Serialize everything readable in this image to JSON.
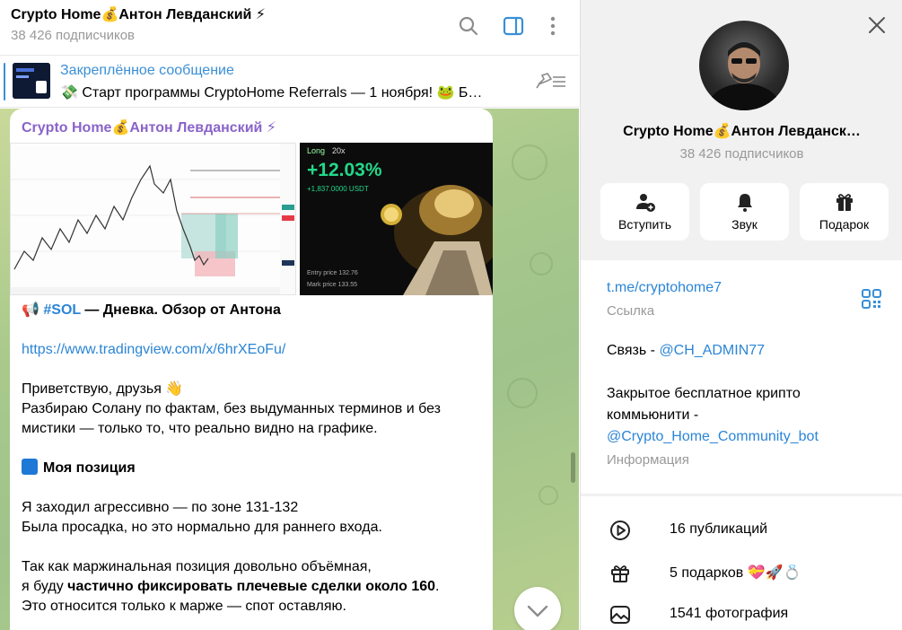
{
  "header": {
    "title": "Crypto Home💰Антон Левданский ⚡",
    "subscribers": "38 426 подписчиков"
  },
  "pinned": {
    "label": "Закреплённое сообщение",
    "text": "💸 Старт программы CryptoHome Referrals — 1 ноября! 🐸 Б…"
  },
  "message": {
    "author": "Crypto Home💰Антон Левданский ⚡",
    "media_right": {
      "mode": "Long",
      "leverage": "20x",
      "pnl_percent": "+12.03%",
      "pnl_usdt": "+1,837.0000 USDT",
      "entry_price": "Entry price  132.76",
      "mark_price": "Mark price  133.55"
    },
    "hashtag": "#SOL",
    "title_rest": " — Дневка. Обзор от Антона",
    "link": "https://www.tradingview.com/x/6hrXEoFu/",
    "p1": "Приветствую, друзья 👋",
    "p2a": "Разбираю Солану по фактам, без выдуманных терминов и без",
    "p2b": "мистики — только то, что реально видно на графике.",
    "position_heading": "Моя позиция",
    "p3a": "Я заходил агрессивно — по зоне 131-132",
    "p3b": "Была просадка, но это нормально для раннего входа.",
    "p4a": "Так как маржинальная позиция довольно объёмная,",
    "p4b_pre": "я буду ",
    "p4b_bold": "частично фиксировать плечевые сделки около 160",
    "p4b_post": ".",
    "p4c": "Это относится только к марже — спот оставляю."
  },
  "profile": {
    "name": "Crypto Home💰Антон Левданск…",
    "subscribers": "38 426 подписчиков",
    "actions": {
      "join": "Вступить",
      "sound": "Звук",
      "gift": "Подарок"
    },
    "link": "t.me/cryptohome7",
    "link_caption": "Ссылка",
    "contact_prefix": "Связь - ",
    "contact_handle": "@CH_ADMIN77",
    "info_line1": "Закрытое бесплатное крипто",
    "info_line2": "коммьюнити -",
    "info_bot": "@Crypto_Home_Community_bot",
    "info_caption": "Информация",
    "stats": {
      "publications": "16 публикаций",
      "gifts": "5 подарков 💝🚀💍",
      "photos": "1541 фотография"
    }
  },
  "colors": {
    "accent": "#3a8fd6",
    "author": "#8a63c9",
    "positive": "#23d88a"
  }
}
